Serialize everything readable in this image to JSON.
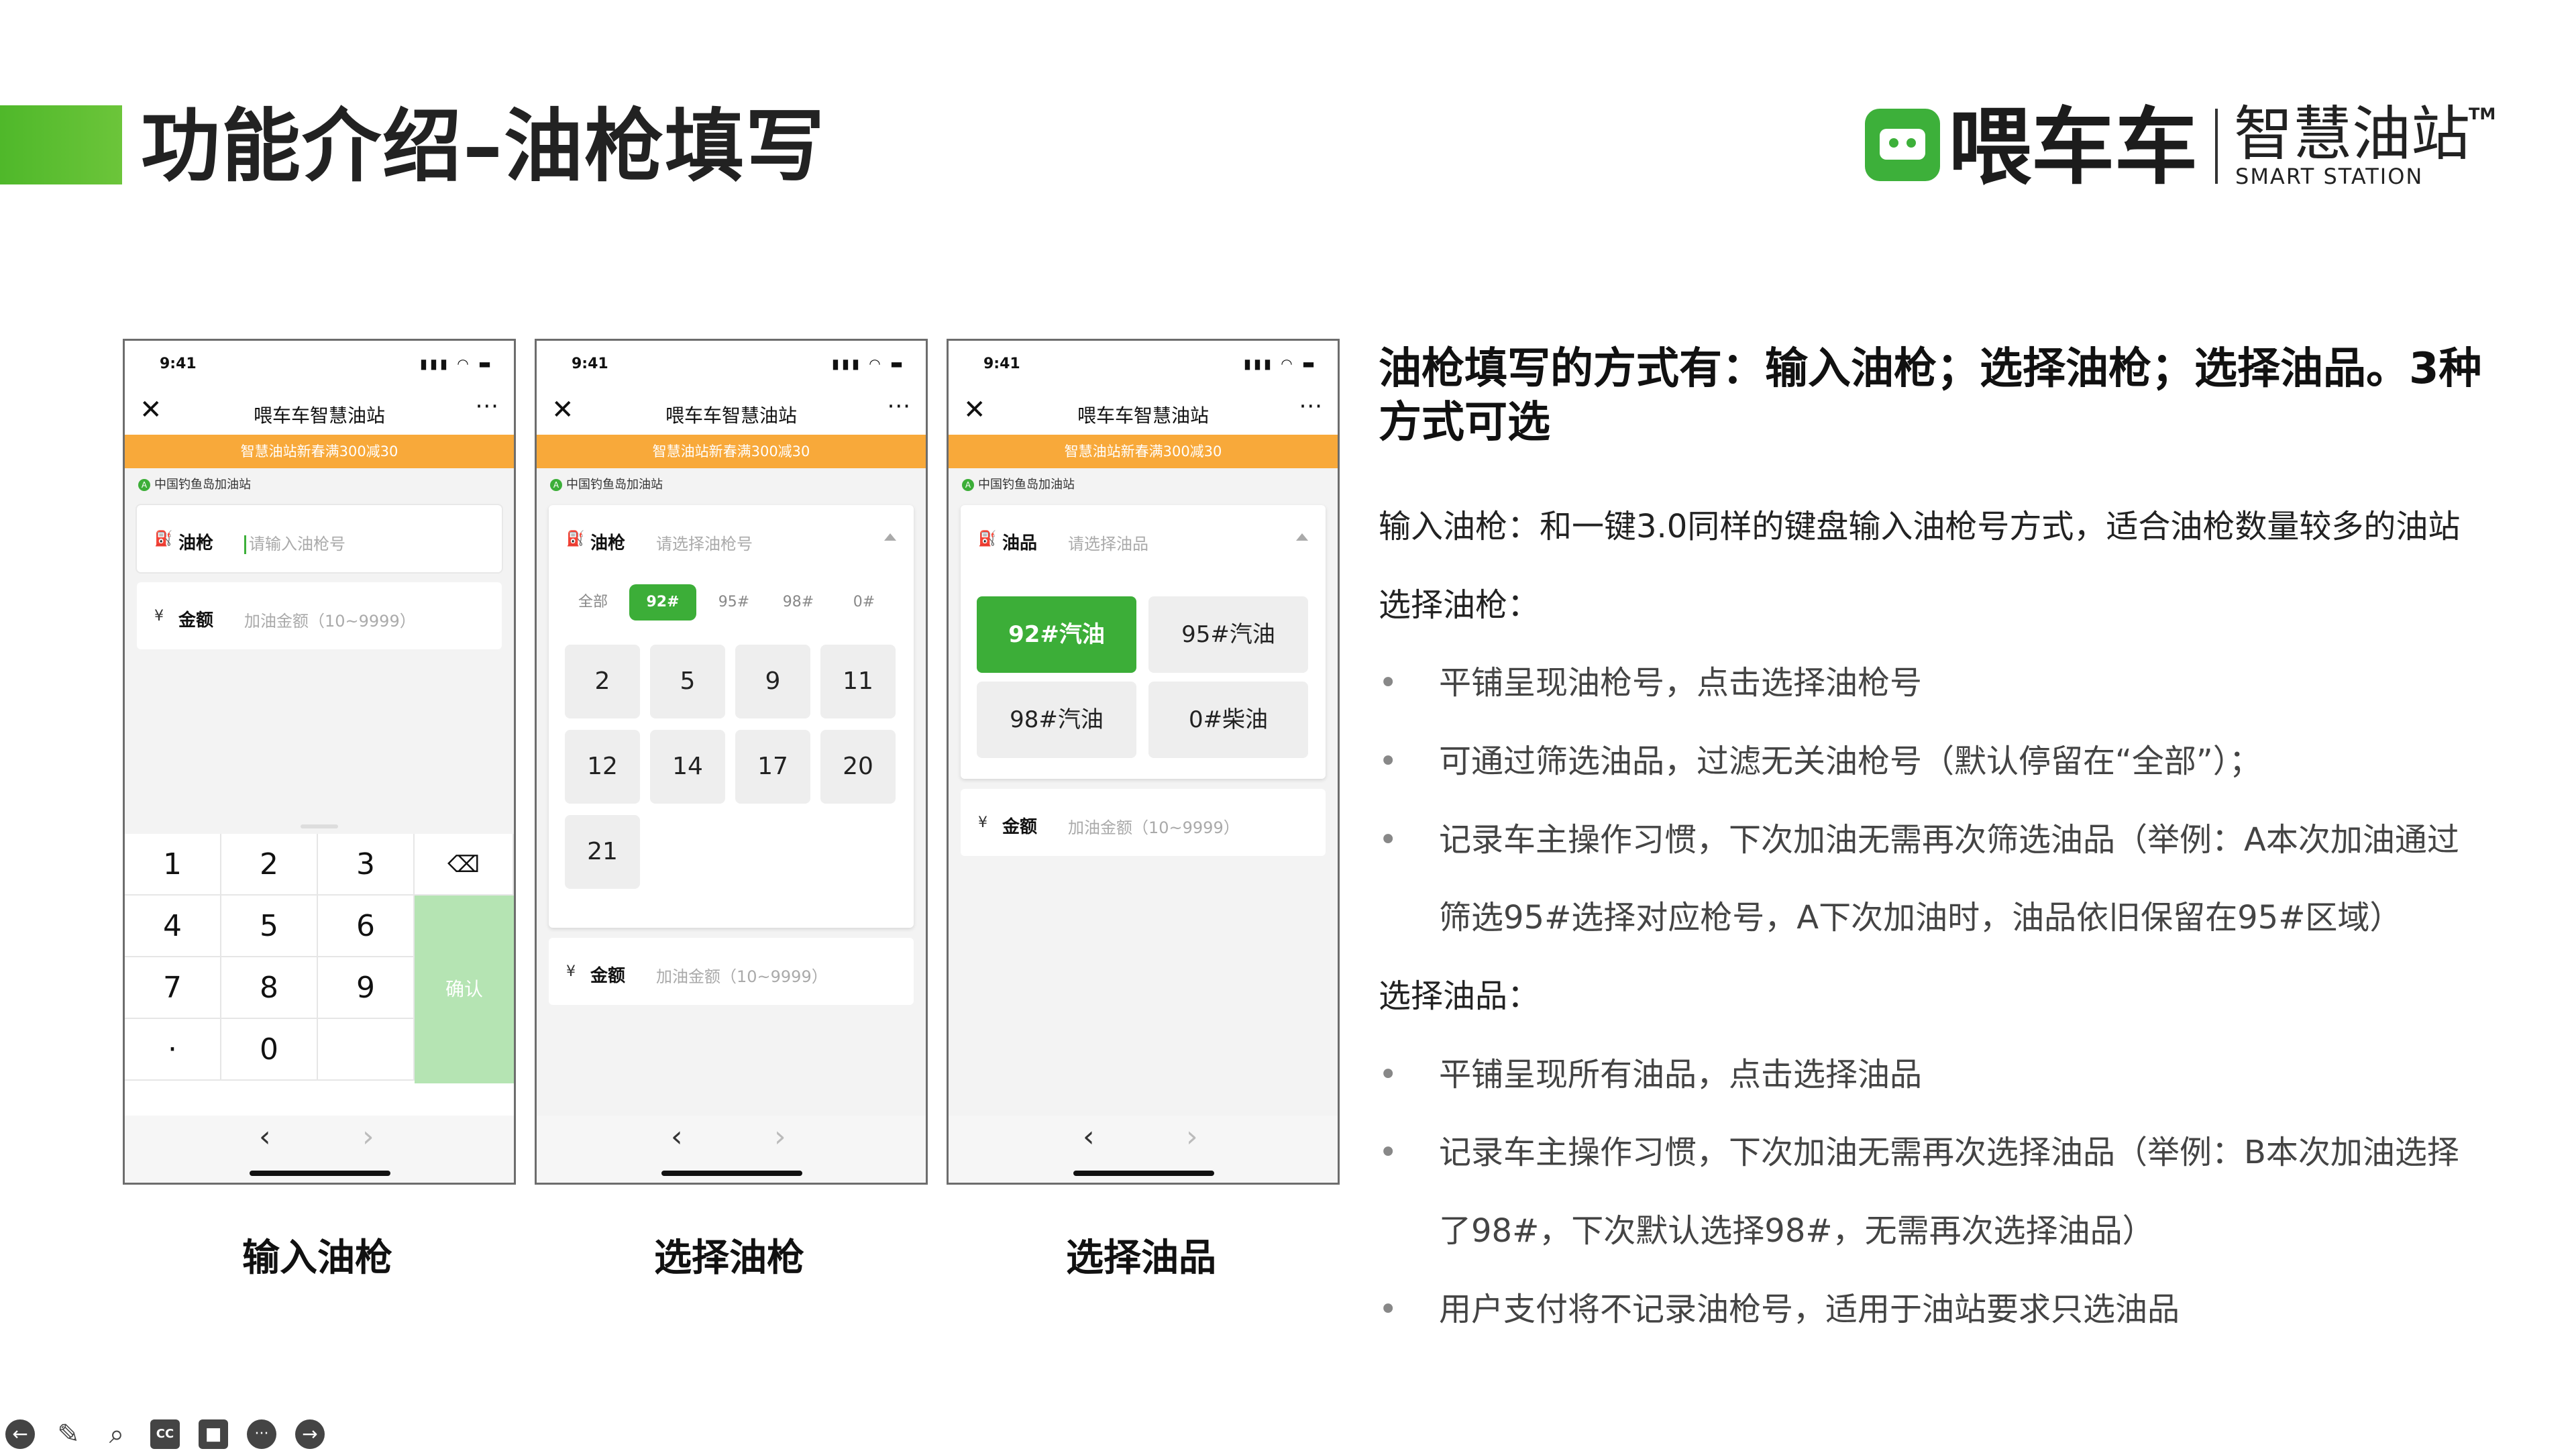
{
  "slide": {
    "title": "功能介绍–油枪填写",
    "accent_color": "#4fb82a"
  },
  "logo": {
    "brand": "喂车车",
    "sub_cn": "智慧油站",
    "sub_en": "SMART STATION",
    "tm": "TM"
  },
  "phone_common": {
    "time": "9:41",
    "status_icons": "▮▮▮ ◠ ▬",
    "close_icon": "✕",
    "nav_title": "喂车车智慧油站",
    "more_icon": "···",
    "promo": "智慧油站新春满300减30",
    "station_badge": "A",
    "station": "中国钓鱼岛加油站",
    "amount_label": "金额",
    "amount_placeholder": "加油金额（10~9999）",
    "prev": "‹",
    "next": "›"
  },
  "phone1": {
    "gun_label": "油枪",
    "gun_placeholder": "请输入油枪号",
    "keys": [
      "1",
      "2",
      "3",
      "4",
      "5",
      "6",
      "7",
      "8",
      "9",
      "·",
      "0"
    ],
    "backspace": "⌫",
    "confirm": "确认",
    "caption": "输入油枪"
  },
  "phone2": {
    "gun_label": "油枪",
    "gun_placeholder": "请选择油枪号",
    "filters": [
      "全部",
      "92#",
      "95#",
      "98#",
      "0#"
    ],
    "active_filter": "92#",
    "guns": [
      "2",
      "5",
      "9",
      "11",
      "12",
      "14",
      "17",
      "20",
      "21"
    ],
    "caption": "选择油枪"
  },
  "phone3": {
    "oil_label": "油品",
    "oil_placeholder": "请选择油品",
    "oils": [
      "92#汽油",
      "95#汽油",
      "98#汽油",
      "0#柴油"
    ],
    "active_oil": "92#汽油",
    "caption": "选择油品"
  },
  "right": {
    "headline": "油枪填写的方式有：输入油枪；选择油枪；选择油品。3种方式可选",
    "input_gun": "输入油枪：和一键3.0同样的键盘输入油枪号方式，适合油枪数量较多的油站",
    "select_gun_title": "选择油枪：",
    "select_gun_bullets": [
      "平铺呈现油枪号，点击选择油枪号",
      "可通过筛选油品，过滤无关油枪号（默认停留在“全部”）；",
      "记录车主操作习惯，下次加油无需再次筛选油品（举例：A本次加油通过"
    ],
    "select_gun_cont": "筛选95#选择对应枪号，A下次加油时，油品依旧保留在95#区域）",
    "select_oil_title": "选择油品：",
    "select_oil_bullets": [
      "平铺呈现所有油品，点击选择油品",
      "记录车主操作习惯，下次加油无需再次选择油品（举例：B本次加油选择"
    ],
    "select_oil_cont": "了98#，下次默认选择98#，无需再次选择油品）",
    "last_bullet": "用户支付将不记录油枪号，适用于油站要求只选油品",
    "bullet": "•"
  },
  "toolbar": {
    "back": "←",
    "pen": "✎",
    "zoom": "⌕",
    "cc": "CC",
    "video": "■",
    "more": "···",
    "forward": "→"
  }
}
